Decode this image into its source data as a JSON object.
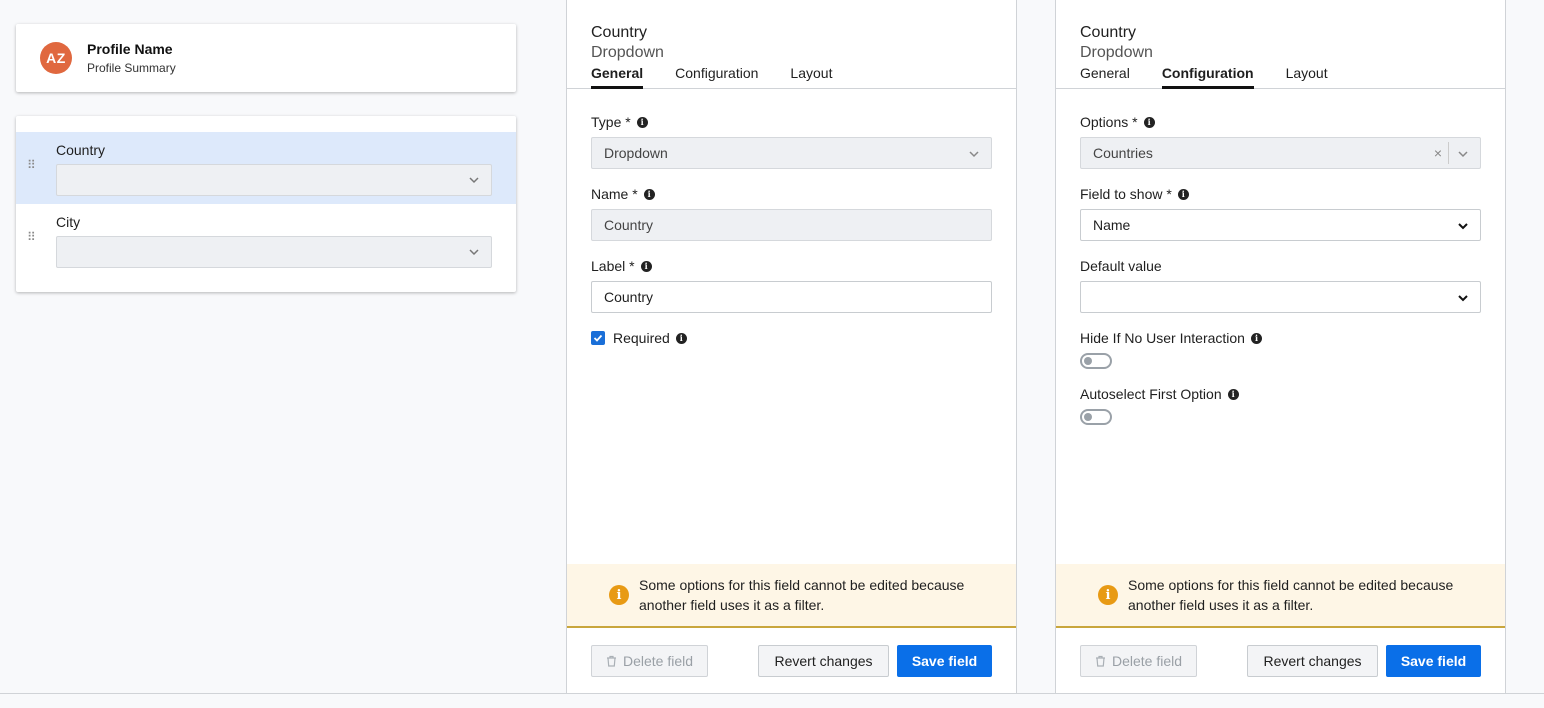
{
  "profile": {
    "initials": "AZ",
    "name": "Profile Name",
    "summary": "Profile Summary",
    "avatar_color": "#e0683f"
  },
  "fields": [
    {
      "label": "Country",
      "selected": true
    },
    {
      "label": "City",
      "selected": false
    }
  ],
  "panel_general": {
    "title": "Country",
    "subtitle": "Dropdown",
    "tabs": [
      {
        "label": "General",
        "active": true
      },
      {
        "label": "Configuration",
        "active": false
      },
      {
        "label": "Layout",
        "active": false
      }
    ],
    "type_label": "Type *",
    "type_value": "Dropdown",
    "name_label": "Name *",
    "name_value": "Country",
    "label_label": "Label *",
    "label_value": "Country",
    "required_label": "Required",
    "required_checked": true
  },
  "panel_config": {
    "title": "Country",
    "subtitle": "Dropdown",
    "tabs": [
      {
        "label": "General",
        "active": false
      },
      {
        "label": "Configuration",
        "active": true
      },
      {
        "label": "Layout",
        "active": false
      }
    ],
    "options_label": "Options *",
    "options_value": "Countries",
    "field_to_show_label": "Field to show *",
    "field_to_show_value": "Name",
    "default_value_label": "Default value",
    "default_value": "",
    "hide_label": "Hide If No User Interaction",
    "hide_on": false,
    "autoselect_label": "Autoselect First Option",
    "autoselect_on": false
  },
  "notice": {
    "text": "Some options for this field cannot be edited because another field uses it as a filter."
  },
  "buttons": {
    "delete": "Delete field",
    "revert": "Revert changes",
    "save": "Save field"
  },
  "colors": {
    "accent": "#0a6fe8",
    "selected_row": "#dde9fb",
    "notice_bg": "#fef6e6",
    "warning": "#e89a14"
  },
  "icons": {
    "info": "info-icon",
    "chevron": "chevron-down-icon",
    "drag": "drag-handle-icon",
    "trash": "trash-icon",
    "warning": "warning-info-icon",
    "clear": "clear-icon"
  }
}
